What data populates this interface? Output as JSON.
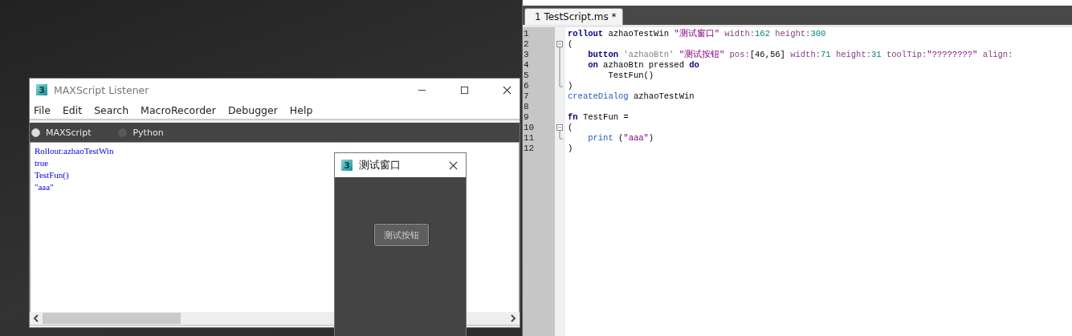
{
  "listener": {
    "app_icon": "3",
    "title": "MAXScript Listener",
    "menu": [
      "File",
      "Edit",
      "Search",
      "MacroRecorder",
      "Debugger",
      "Help"
    ],
    "languages": [
      {
        "label": "MAXScript",
        "selected": true
      },
      {
        "label": "Python",
        "selected": false
      }
    ],
    "output": [
      "Rollout:azhaoTestWin",
      "true",
      "TestFun()",
      "\"aaa\""
    ]
  },
  "dialog": {
    "app_icon": "3",
    "title": "测试窗口",
    "button": "测试按钮"
  },
  "editor": {
    "tabs": [
      {
        "label": "1 TestScript.ms *",
        "selected": true
      }
    ],
    "lines": [
      {
        "number": "1",
        "tokens": [
          {
            "text": "rollout",
            "kind": "keyword"
          },
          {
            "text": " azhaoTestWin ",
            "kind": "plain"
          },
          {
            "text": "\"测试窗口\"",
            "kind": "string"
          },
          {
            "text": " width:",
            "kind": "param"
          },
          {
            "text": "162",
            "kind": "number"
          },
          {
            "text": " height:",
            "kind": "param"
          },
          {
            "text": "300",
            "kind": "number"
          }
        ]
      },
      {
        "number": "2",
        "kind": "fold-open",
        "tokens": [
          {
            "text": "(",
            "kind": "plain"
          }
        ]
      },
      {
        "number": "3",
        "kind": "fold-line",
        "tokens": [
          {
            "text": "    button",
            "kind": "keyword"
          },
          {
            "text": " 'azhaoBtn' ",
            "kind": "name"
          },
          {
            "text": "\"测试按钮\"",
            "kind": "string"
          },
          {
            "text": " pos:",
            "kind": "param"
          },
          {
            "text": "[46,56]",
            "kind": "plain"
          },
          {
            "text": " width:",
            "kind": "param"
          },
          {
            "text": "71",
            "kind": "number"
          },
          {
            "text": " height:",
            "kind": "param"
          },
          {
            "text": "31",
            "kind": "number"
          },
          {
            "text": " toolTip:",
            "kind": "param"
          },
          {
            "text": "\"????????\"",
            "kind": "string"
          },
          {
            "text": " align:",
            "kind": "param"
          }
        ]
      },
      {
        "number": "4",
        "kind": "fold-line",
        "tokens": [
          {
            "text": "    on",
            "kind": "keyword"
          },
          {
            "text": " azhaoBtn pressed ",
            "kind": "plain"
          },
          {
            "text": "do",
            "kind": "keyword"
          }
        ]
      },
      {
        "number": "5",
        "kind": "fold-line",
        "tokens": [
          {
            "text": "        TestFun()",
            "kind": "plain"
          }
        ]
      },
      {
        "number": "6",
        "kind": "fold-end",
        "tokens": [
          {
            "text": ")",
            "kind": "plain"
          }
        ]
      },
      {
        "number": "7",
        "tokens": [
          {
            "text": "createDialog",
            "kind": "function"
          },
          {
            "text": " azhaoTestWin",
            "kind": "plain"
          }
        ]
      },
      {
        "number": "8"
      },
      {
        "number": "9",
        "tokens": [
          {
            "text": "fn",
            "kind": "keyword"
          },
          {
            "text": " TestFun =",
            "kind": "plain"
          }
        ]
      },
      {
        "number": "10",
        "kind": "fold-open",
        "tokens": [
          {
            "text": "(",
            "kind": "plain"
          }
        ]
      },
      {
        "number": "11",
        "kind": "fold-end",
        "tokens": [
          {
            "text": "    print",
            "kind": "function"
          },
          {
            "text": " (",
            "kind": "plain"
          },
          {
            "text": "\"aaa\"",
            "kind": "string"
          },
          {
            "text": ")",
            "kind": "plain"
          }
        ]
      },
      {
        "number": "12",
        "tokens": [
          {
            "text": ")",
            "kind": "plain"
          }
        ]
      }
    ]
  }
}
